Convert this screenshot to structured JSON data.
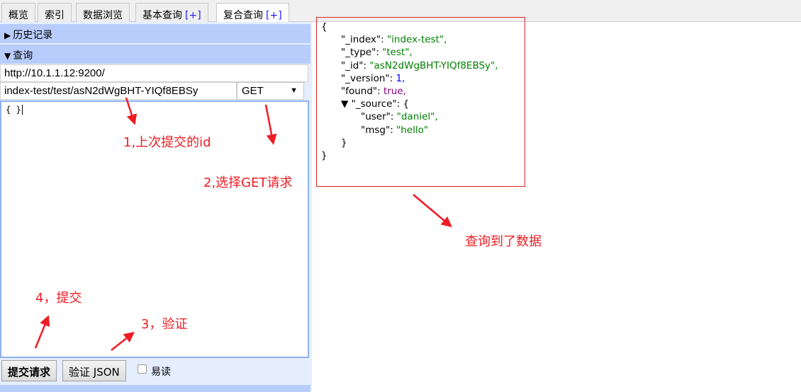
{
  "tabs": [
    {
      "label": "概览"
    },
    {
      "label": "索引"
    },
    {
      "label": "数据浏览"
    },
    {
      "label": "基本查询",
      "plus": "[+]"
    },
    {
      "label": "复合查询",
      "plus": "[+]"
    }
  ],
  "history": {
    "label": "历史记录"
  },
  "query": {
    "label": "查询",
    "url": "http://10.1.1.12:9200/",
    "path": "index-test/test/asN2dWgBHT-YIQf8EBSy",
    "method": "GET",
    "body": "{ }"
  },
  "actions": {
    "submit": "提交请求",
    "validate": "验证 JSON",
    "pretty": "易读"
  },
  "result": {
    "open": "{",
    "close": "}",
    "rows": [
      {
        "indent": 1,
        "key": "\"_index\"",
        "value": "\"index-test\",",
        "type": "str"
      },
      {
        "indent": 1,
        "key": "\"_type\"",
        "value": "\"test\",",
        "type": "str"
      },
      {
        "indent": 1,
        "key": "\"_id\"",
        "value": "\"asN2dWgBHT-YIQf8EBSy\",",
        "type": "str"
      },
      {
        "indent": 1,
        "key": "\"_version\"",
        "value": "1,",
        "type": "num"
      },
      {
        "indent": 1,
        "key": "\"found\"",
        "value": "true,",
        "type": "bool"
      },
      {
        "indent": 1,
        "key": "▼ \"_source\"",
        "value": "{",
        "type": "plain"
      },
      {
        "indent": 2,
        "key": "\"user\"",
        "value": "\"daniel\",",
        "type": "str"
      },
      {
        "indent": 2,
        "key": "\"msg\"",
        "value": "\"hello\"",
        "type": "str"
      },
      {
        "indent": 1,
        "key": "",
        "value": "}",
        "type": "plain"
      }
    ]
  },
  "annotations": {
    "a1": "1,上次提交的id",
    "a2": "2,选择GET请求",
    "a3": "3，验证",
    "a4": "4，提交",
    "a5": "查询到了数据"
  },
  "colors": {
    "annotation": "#f01c24",
    "section": "#b8cdfc"
  }
}
